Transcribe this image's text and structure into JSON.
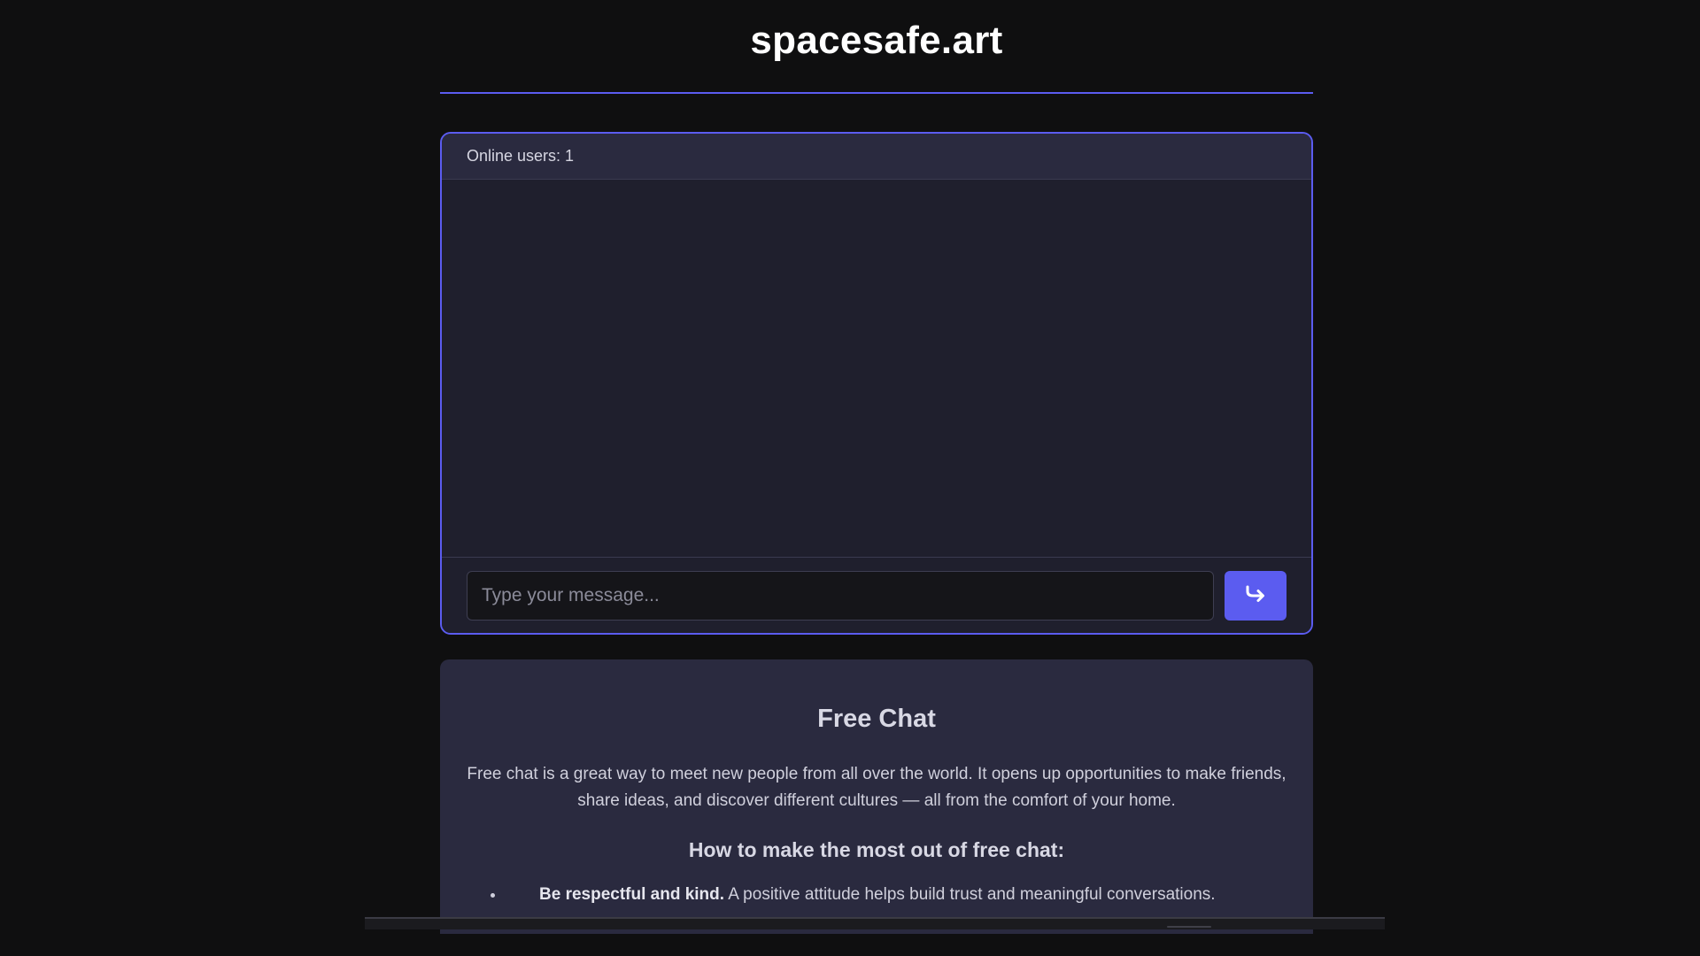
{
  "site": {
    "title": "spacesafe.art"
  },
  "chat": {
    "online_label": "Online users: 1",
    "input_placeholder": "Type your message...",
    "send_icon": "reply-arrow-icon"
  },
  "info": {
    "title": "Free Chat",
    "paragraph": "Free chat is a great way to meet new people from all over the world. It opens up opportunities to make friends, share ideas, and discover different cultures — all from the comfort of your home.",
    "subtitle": "How to make the most out of free chat:",
    "tips": [
      {
        "bold": "Be respectful and kind.",
        "text": " A positive attitude helps build trust and meaningful conversations."
      }
    ]
  },
  "colors": {
    "background": "#0f0f10",
    "accent": "#5b5cf0",
    "panel": "#1f1f2d",
    "card": "#2a2a3f"
  }
}
